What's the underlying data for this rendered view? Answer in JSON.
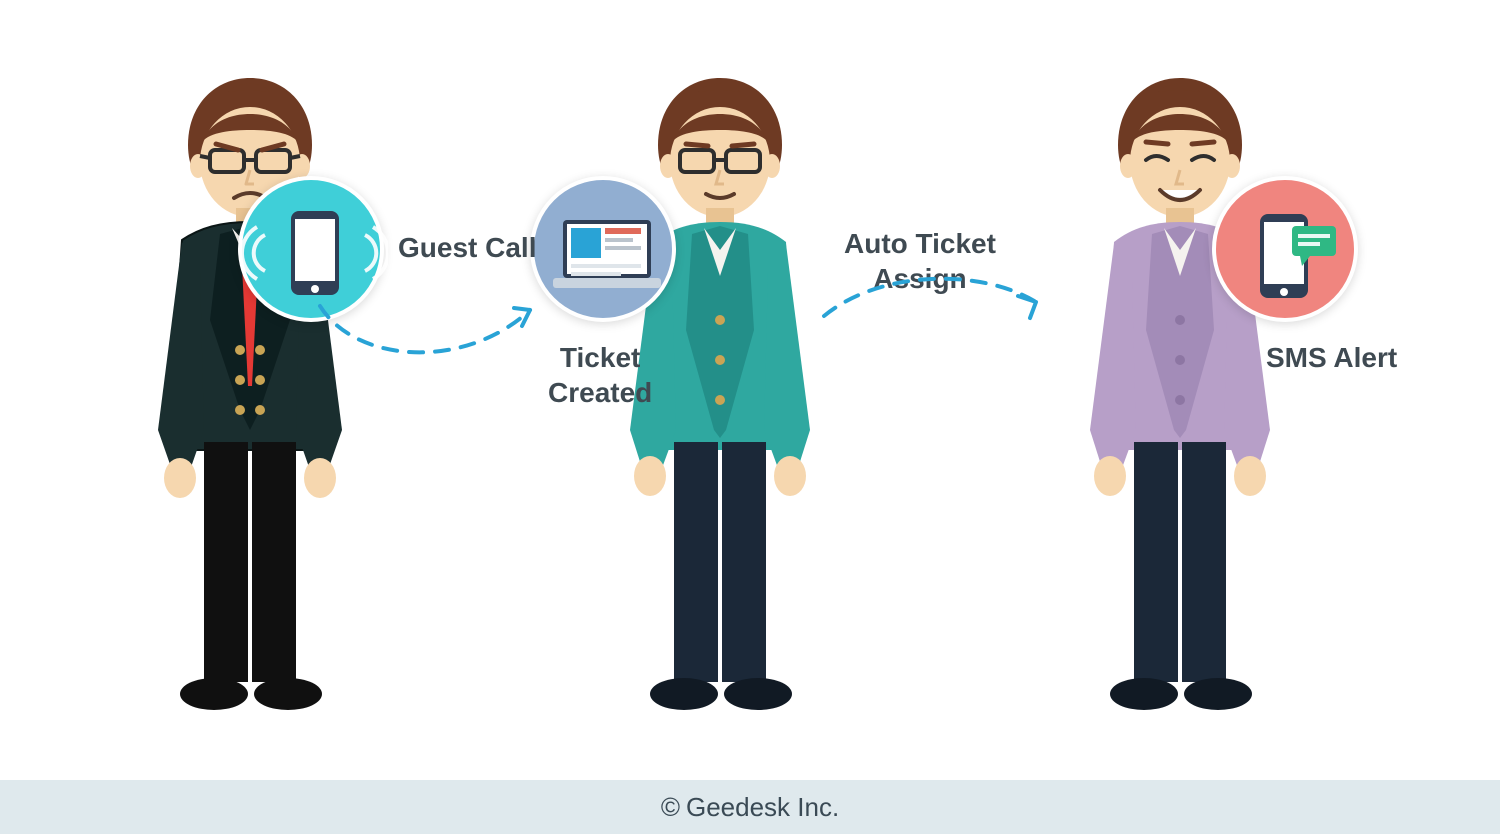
{
  "steps": {
    "guest_call": "Guest Call",
    "ticket_created": "Ticket\nCreated",
    "auto_assign": "Auto Ticket\nAssign",
    "sms_alert": "SMS Alert"
  },
  "footer": "Geedesk Inc.",
  "colors": {
    "arrow": "#29a3d6",
    "icon_bg_phone": "#3fcfd8",
    "icon_bg_laptop": "#91aed1",
    "icon_bg_sms": "#f0857f",
    "footer_bg": "#dfe9ed",
    "label": "#3f4a52",
    "hair": "#6e3a23",
    "skin": "#f6d7af",
    "skin_shadow": "#e8c392",
    "suit_dark": "#1a2e2f",
    "suit_dark_outline": "#0b1616",
    "tie_red": "#e53935",
    "shirt_white": "#f5f3ef",
    "cardigan_teal": "#2fa8a0",
    "cardigan_teal_dark": "#238f89",
    "cardigan_purple": "#b79fc8",
    "cardigan_purple_dark": "#a38cb8",
    "pants_dark": "#1b2838",
    "glasses": "#2e2e2e",
    "button_gold": "#c9a454"
  }
}
